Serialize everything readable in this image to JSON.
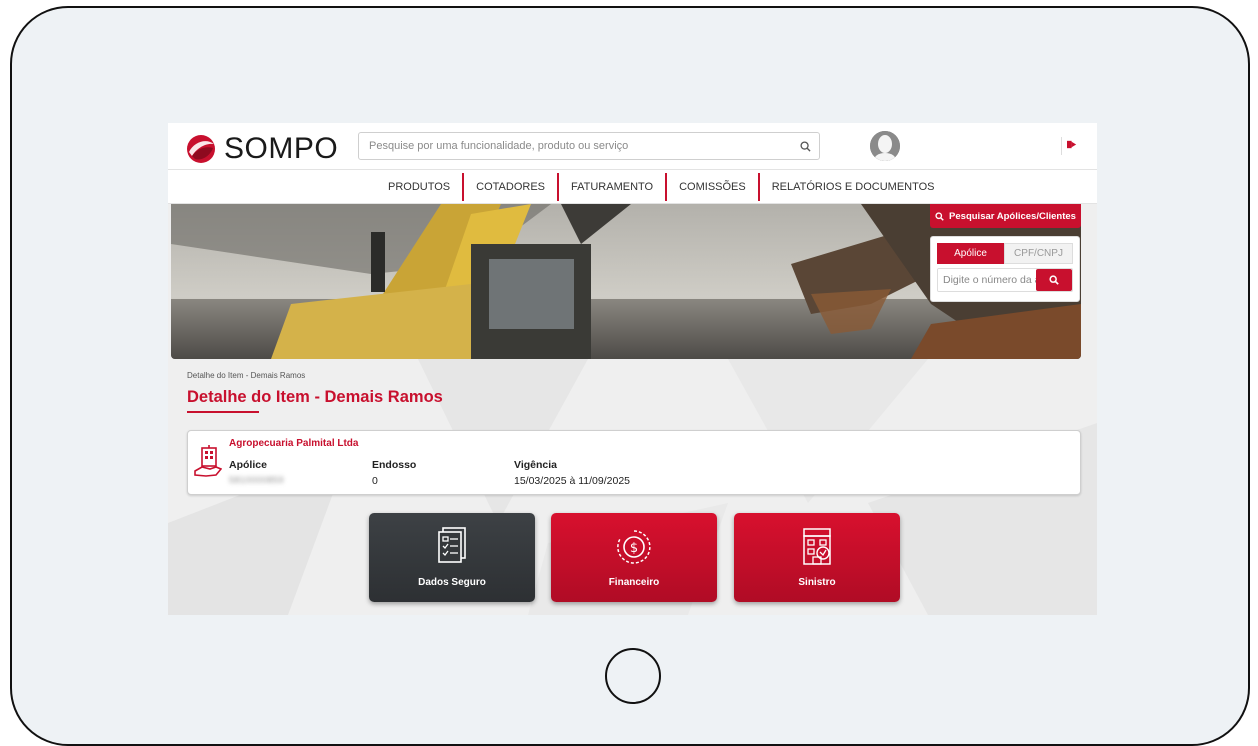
{
  "header": {
    "logo_text": "SOMPO",
    "search_placeholder": "Pesquise por uma funcionalidade, produto ou serviço"
  },
  "nav": {
    "items": [
      "PRODUTOS",
      "COTADORES",
      "FATURAMENTO",
      "COMISSÕES",
      "RELATÓRIOS E DOCUMENTOS"
    ]
  },
  "quick_search": {
    "button_label": "Pesquisar Apólices/Clientes",
    "tabs": [
      "Apólice",
      "CPF/CNPJ"
    ],
    "active_tab": "Apólice",
    "input_placeholder": "Digite o número da apólice"
  },
  "breadcrumb": "Detalhe do Item - Demais Ramos",
  "page_title": "Detalhe do Item - Demais Ramos",
  "policy": {
    "company": "Agropecuaria Palmital Ltda",
    "apolice_label": "Apólice",
    "apolice_value": "5810000859",
    "endosso_label": "Endosso",
    "endosso_value": "0",
    "vigencia_label": "Vigência",
    "vigencia_value": "15/03/2025 à 11/09/2025"
  },
  "tiles": [
    {
      "label": "Dados Seguro",
      "icon": "document-list-icon"
    },
    {
      "label": "Financeiro",
      "icon": "dollar-coin-icon"
    },
    {
      "label": "Sinistro",
      "icon": "house-claim-icon"
    }
  ],
  "colors": {
    "brand_red": "#c8102e",
    "tile_dark": "#35383b"
  }
}
